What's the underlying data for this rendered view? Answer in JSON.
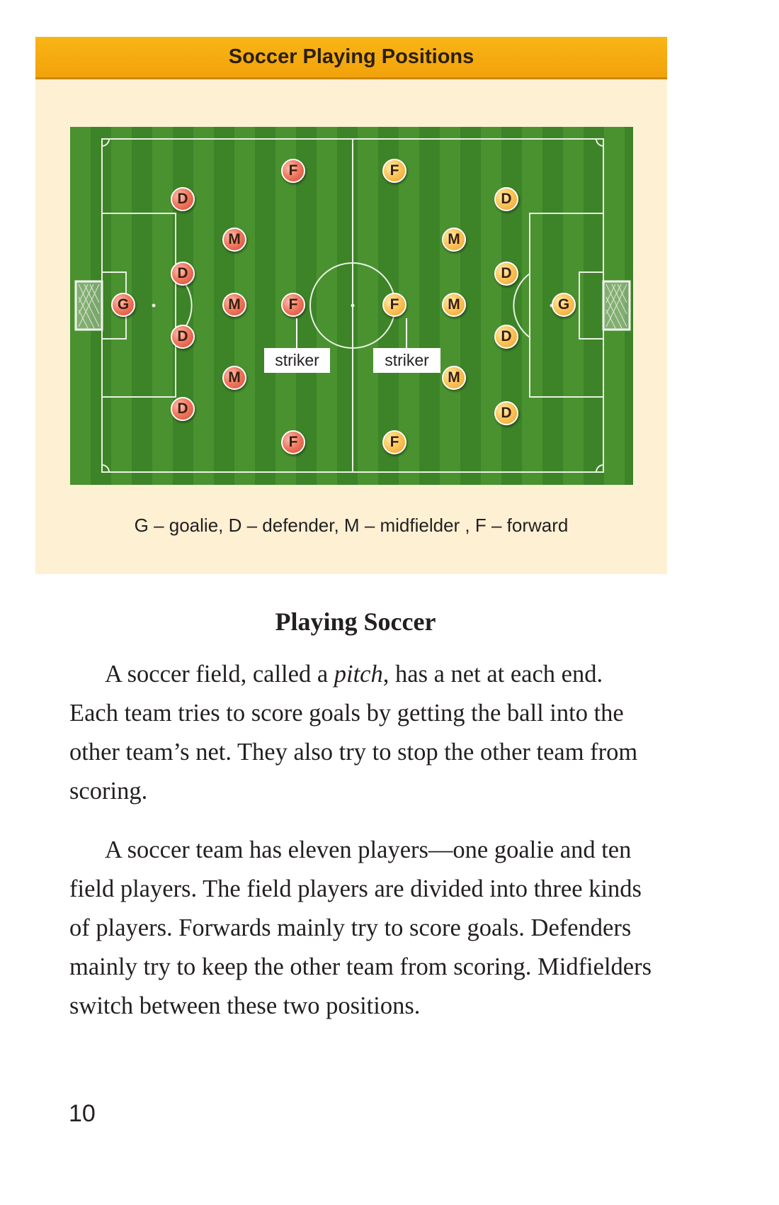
{
  "sidebar": {
    "title": "Soccer Playing Positions",
    "legend": "G – goalie, D – defender, M – midfielder , F – forward",
    "striker_label_left": "striker",
    "striker_label_right": "striker",
    "colors": {
      "header": "#f5a70f",
      "panel": "#fdf0d3",
      "pitch": "#4a9230",
      "red_team": "#e5664f",
      "orange_team": "#f7b545"
    },
    "players": [
      {
        "team": "red",
        "letter": "G"
      },
      {
        "team": "red",
        "letter": "D"
      },
      {
        "team": "red",
        "letter": "D"
      },
      {
        "team": "red",
        "letter": "D"
      },
      {
        "team": "red",
        "letter": "D"
      },
      {
        "team": "red",
        "letter": "M"
      },
      {
        "team": "red",
        "letter": "M"
      },
      {
        "team": "red",
        "letter": "M"
      },
      {
        "team": "red",
        "letter": "F"
      },
      {
        "team": "red",
        "letter": "F"
      },
      {
        "team": "red",
        "letter": "F"
      },
      {
        "team": "orange",
        "letter": "G"
      },
      {
        "team": "orange",
        "letter": "D"
      },
      {
        "team": "orange",
        "letter": "D"
      },
      {
        "team": "orange",
        "letter": "D"
      },
      {
        "team": "orange",
        "letter": "D"
      },
      {
        "team": "orange",
        "letter": "M"
      },
      {
        "team": "orange",
        "letter": "M"
      },
      {
        "team": "orange",
        "letter": "M"
      },
      {
        "team": "orange",
        "letter": "F"
      },
      {
        "team": "orange",
        "letter": "F"
      },
      {
        "team": "orange",
        "letter": "F"
      }
    ]
  },
  "section_title": "Playing Soccer",
  "paragraph1": {
    "before_italic": "A soccer field, called a ",
    "italic": "pitch",
    "after_italic": ", has a net at each end. Each team tries to score goals by getting the ball into the other team’s net. They also try to stop the other team from scoring."
  },
  "paragraph2": "A soccer team has eleven players—one goalie and ten field players. The field players are divided into three kinds of players. Forwards mainly try to score goals. Defenders mainly try to keep the other team from scoring. Midfielders switch between these two positions.",
  "page_number": "10"
}
